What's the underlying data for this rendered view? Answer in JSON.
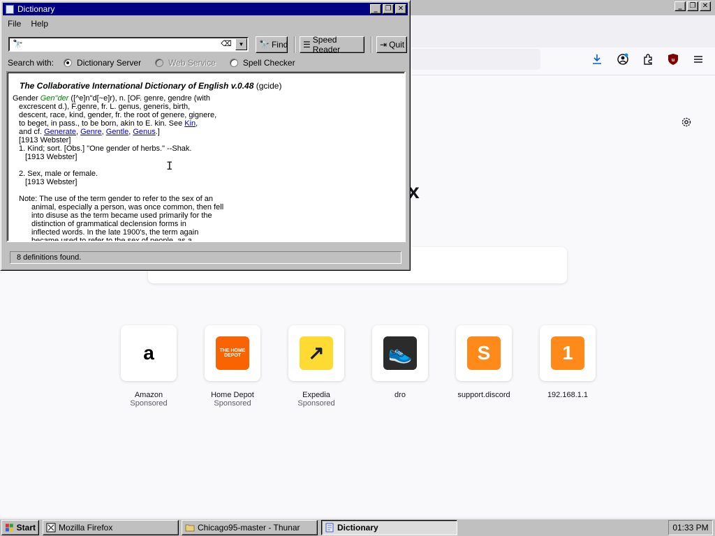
{
  "firefox": {
    "tiles": [
      {
        "label": "Amazon",
        "sub": "Sponsored",
        "glyph": "a",
        "bg": "#ffffff",
        "fg": "#000000"
      },
      {
        "label": "Home Depot",
        "sub": "Sponsored",
        "glyph": "THE HOME DEPOT",
        "bg": "#f96302",
        "fg": "#ffffff"
      },
      {
        "label": "Expedia",
        "sub": "Sponsored",
        "glyph": "↗",
        "bg": "#fddb32",
        "fg": "#191e3b"
      },
      {
        "label": "dro",
        "sub": "",
        "glyph": "👟",
        "bg": "#2b2b2b",
        "fg": "#ff9a3c"
      },
      {
        "label": "support.discord",
        "sub": "",
        "glyph": "S",
        "bg": "#ff8a1a",
        "fg": "#ffffff"
      },
      {
        "label": "192.168.1.1",
        "sub": "",
        "glyph": "1",
        "bg": "#ff8a1a",
        "fg": "#ffffff"
      }
    ],
    "wordmark_fragment": "x",
    "icons": [
      "download-icon",
      "account-icon",
      "extensions-icon",
      "ublock-icon",
      "menu-icon",
      "settings-gear-icon"
    ]
  },
  "dictionary": {
    "title": "Dictionary",
    "menu": [
      "File",
      "Help"
    ],
    "search_value": "",
    "buttons": {
      "find": "Find",
      "speed_reader": "Speed Reader",
      "quit": "Quit"
    },
    "search_with_label": "Search with:",
    "search_options": [
      {
        "label": "Dictionary Server",
        "selected": true,
        "enabled": true
      },
      {
        "label": "Web Service",
        "selected": false,
        "enabled": false
      },
      {
        "label": "Spell Checker",
        "selected": false,
        "enabled": true
      }
    ],
    "result": {
      "heading": "The Collaborative International Dictionary of English v.0.48",
      "source": "(gcide)",
      "line1_pre": "Gender ",
      "line1_hw": "Gen\"der",
      "line1_post": " ([^e]n\"d[~e]r), n. [OF. genre, gendre (with",
      "line2": "excrescent d.), F.genre, fr. L. genus, generis, birth,",
      "line3": "descent, race, kind, gender, fr. the root of genere, gignere,",
      "line4_pre": "to beget, in pass., to be born, akin to E. kin. See ",
      "line4_link": "Kin",
      "line4_post": ",",
      "line5_pre": "and cf. ",
      "links": [
        "Generate",
        "Genre",
        "Gentle",
        "Genus"
      ],
      "line5_post": ".]",
      "webster1": "[1913 Webster]",
      "sense1": "1. Kind; sort. [Obs.] \"One gender of herbs.\" --Shak.",
      "webster2": "[1913 Webster]",
      "sense2": "2. Sex, male or female.",
      "webster3": "[1913 Webster]",
      "note1": "Note: The use of the term gender to refer to the sex of an",
      "note2": "animal, especially a person, was once common, then fell",
      "note3": "into disuse as the term became used primarily for the",
      "note4": "distinction of grammatical declension forms in",
      "note5": "inflected words. In the late 1900's, the term again",
      "note6": "became used to refer to the sex of people, as a"
    },
    "status": "8 definitions found."
  },
  "taskbar": {
    "start": "Start",
    "tasks": [
      {
        "label": "Mozilla Firefox",
        "active": false
      },
      {
        "label": "Chicago95-master - Thunar",
        "active": false
      },
      {
        "label": "Dictionary",
        "active": true
      }
    ],
    "clock": "01:33 PM"
  }
}
